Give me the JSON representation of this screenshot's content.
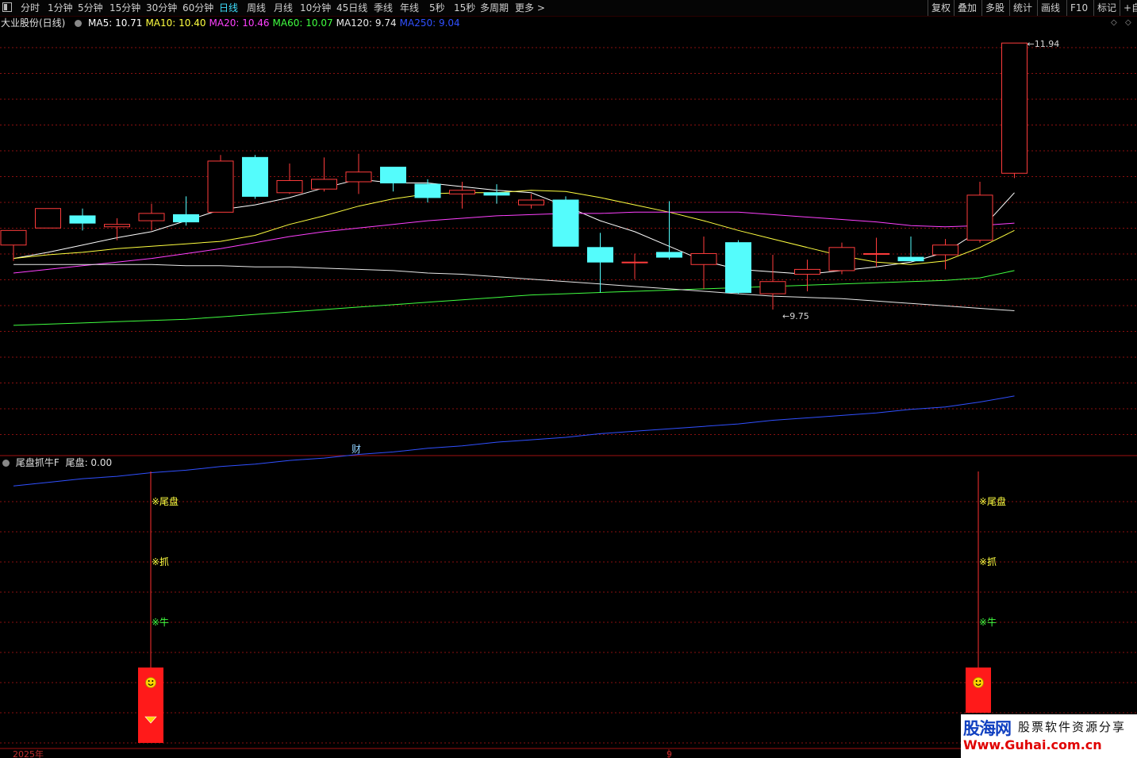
{
  "toolbar": {
    "periods": [
      "分时",
      "1分钟",
      "5分钟",
      "15分钟",
      "30分钟",
      "60分钟",
      "日线",
      "周线",
      "月线",
      "10分钟",
      "45日线",
      "季线",
      "年线",
      "5秒",
      "15秒",
      "多周期",
      "更多 >"
    ],
    "active_period": "日线",
    "right_buttons": [
      "复权",
      "叠加",
      "多股",
      "统计",
      "画线",
      "F10",
      "标记",
      "+自"
    ]
  },
  "main_legend": {
    "title": "大业股份(日线)",
    "items": [
      {
        "label": "MA5: 10.71",
        "color": "#ffffff"
      },
      {
        "label": "MA10: 10.40",
        "color": "#ffff40"
      },
      {
        "label": "MA20: 10.46",
        "color": "#ff40ff"
      },
      {
        "label": "MA60: 10.07",
        "color": "#40ff40"
      },
      {
        "label": "MA120: 9.74",
        "color": "#e8e8e8"
      },
      {
        "label": "MA250: 9.04",
        "color": "#3050ff"
      }
    ]
  },
  "sub_legend": {
    "title": "尾盘抓牛F",
    "value_label": "尾盘: 0.00"
  },
  "annotations": {
    "high_label": "11.94",
    "low_label": "9.75",
    "finance_marker": "财"
  },
  "signal_labels": [
    {
      "text": "※尾盘",
      "color": "#ffff40"
    },
    {
      "text": "※抓",
      "color": "#ffff40"
    },
    {
      "text": "※牛",
      "color": "#40ff40"
    }
  ],
  "time_axis": {
    "labels": [
      "2025年",
      "9"
    ]
  },
  "watermark": {
    "line1": "股海网",
    "line2": "股票软件资源分享",
    "line3": "Www.Guhai.com.cn"
  },
  "colors": {
    "up": "#ff3c3c",
    "down": "#54fcfc",
    "grid": "#8a1010",
    "signal_box": "#ff1a1a"
  },
  "chart_data": {
    "type": "candlestick",
    "title": "大业股份(日线)",
    "price_range": [
      9.0,
      12.0
    ],
    "candles": [
      {
        "o": 10.28,
        "h": 10.4,
        "l": 10.15,
        "c": 10.4
      },
      {
        "o": 10.42,
        "h": 10.58,
        "l": 10.42,
        "c": 10.58
      },
      {
        "o": 10.52,
        "h": 10.58,
        "l": 10.4,
        "c": 10.46
      },
      {
        "o": 10.43,
        "h": 10.5,
        "l": 10.32,
        "c": 10.45
      },
      {
        "o": 10.48,
        "h": 10.62,
        "l": 10.4,
        "c": 10.54
      },
      {
        "o": 10.53,
        "h": 10.68,
        "l": 10.44,
        "c": 10.47
      },
      {
        "o": 10.55,
        "h": 11.02,
        "l": 10.55,
        "c": 10.97
      },
      {
        "o": 11.0,
        "h": 11.02,
        "l": 10.66,
        "c": 10.68
      },
      {
        "o": 10.71,
        "h": 10.95,
        "l": 10.7,
        "c": 10.81
      },
      {
        "o": 10.74,
        "h": 11.0,
        "l": 10.72,
        "c": 10.82
      },
      {
        "o": 10.8,
        "h": 11.03,
        "l": 10.7,
        "c": 10.88
      },
      {
        "o": 10.92,
        "h": 10.92,
        "l": 10.72,
        "c": 10.79
      },
      {
        "o": 10.78,
        "h": 10.82,
        "l": 10.63,
        "c": 10.67
      },
      {
        "o": 10.7,
        "h": 10.8,
        "l": 10.58,
        "c": 10.73
      },
      {
        "o": 10.71,
        "h": 10.78,
        "l": 10.62,
        "c": 10.69
      },
      {
        "o": 10.61,
        "h": 10.7,
        "l": 10.58,
        "c": 10.65
      },
      {
        "o": 10.65,
        "h": 10.68,
        "l": 10.3,
        "c": 10.27
      },
      {
        "o": 10.26,
        "h": 10.38,
        "l": 9.89,
        "c": 10.14
      },
      {
        "o": 10.14,
        "h": 10.21,
        "l": 10.0,
        "c": 10.14
      },
      {
        "o": 10.22,
        "h": 10.64,
        "l": 10.16,
        "c": 10.18
      },
      {
        "o": 10.12,
        "h": 10.35,
        "l": 9.92,
        "c": 10.21
      },
      {
        "o": 10.3,
        "h": 10.32,
        "l": 9.88,
        "c": 9.89
      },
      {
        "o": 9.88,
        "h": 10.2,
        "l": 9.75,
        "c": 9.98
      },
      {
        "o": 10.04,
        "h": 10.16,
        "l": 9.9,
        "c": 10.08
      },
      {
        "o": 10.07,
        "h": 10.3,
        "l": 10.04,
        "c": 10.26
      },
      {
        "o": 10.21,
        "h": 10.34,
        "l": 10.1,
        "c": 10.21
      },
      {
        "o": 10.18,
        "h": 10.35,
        "l": 10.15,
        "c": 10.15
      },
      {
        "o": 10.2,
        "h": 10.33,
        "l": 10.08,
        "c": 10.28
      },
      {
        "o": 10.32,
        "h": 10.8,
        "l": 10.3,
        "c": 10.69
      },
      {
        "o": 10.87,
        "h": 11.94,
        "l": 10.83,
        "c": 11.94
      }
    ],
    "ma": [
      {
        "name": "MA5",
        "color": "#ffffff",
        "values": [
          10.17,
          10.22,
          10.28,
          10.34,
          10.39,
          10.48,
          10.57,
          10.61,
          10.67,
          10.75,
          10.82,
          10.79,
          10.79,
          10.76,
          10.73,
          10.71,
          10.6,
          10.48,
          10.39,
          10.27,
          10.15,
          10.08,
          10.06,
          10.04,
          10.07,
          10.1,
          10.14,
          10.22,
          10.4,
          10.71
        ]
      },
      {
        "name": "MA10",
        "color": "#ffff40",
        "values": [
          10.17,
          10.2,
          10.22,
          10.25,
          10.27,
          10.29,
          10.31,
          10.36,
          10.45,
          10.52,
          10.6,
          10.66,
          10.7,
          10.71,
          10.71,
          10.73,
          10.72,
          10.67,
          10.61,
          10.55,
          10.48,
          10.4,
          10.33,
          10.26,
          10.19,
          10.14,
          10.12,
          10.15,
          10.26,
          10.4
        ]
      },
      {
        "name": "MA20",
        "color": "#ff40ff",
        "values": [
          10.05,
          10.08,
          10.11,
          10.14,
          10.17,
          10.21,
          10.25,
          10.3,
          10.35,
          10.39,
          10.42,
          10.45,
          10.48,
          10.5,
          10.52,
          10.53,
          10.54,
          10.54,
          10.55,
          10.55,
          10.55,
          10.55,
          10.53,
          10.51,
          10.49,
          10.47,
          10.44,
          10.43,
          10.44,
          10.46
        ]
      },
      {
        "name": "MA60",
        "color": "#40ff40",
        "values": [
          9.62,
          9.63,
          9.64,
          9.65,
          9.66,
          9.67,
          9.69,
          9.71,
          9.73,
          9.75,
          9.77,
          9.79,
          9.81,
          9.83,
          9.85,
          9.87,
          9.88,
          9.89,
          9.9,
          9.91,
          9.92,
          9.93,
          9.94,
          9.95,
          9.96,
          9.97,
          9.98,
          9.99,
          10.01,
          10.07
        ]
      },
      {
        "name": "MA120",
        "color": "#e8e8e8",
        "values": [
          10.12,
          10.12,
          10.12,
          10.12,
          10.12,
          10.11,
          10.11,
          10.1,
          10.1,
          10.09,
          10.08,
          10.07,
          10.05,
          10.04,
          10.02,
          10.0,
          9.98,
          9.96,
          9.94,
          9.92,
          9.9,
          9.88,
          9.86,
          9.85,
          9.84,
          9.82,
          9.8,
          9.78,
          9.76,
          9.74
        ]
      },
      {
        "name": "MA250",
        "color": "#3050ff",
        "values": [
          8.3,
          8.33,
          8.36,
          8.38,
          8.41,
          8.43,
          8.46,
          8.48,
          8.51,
          8.53,
          8.56,
          8.58,
          8.61,
          8.63,
          8.66,
          8.68,
          8.7,
          8.73,
          8.75,
          8.77,
          8.79,
          8.81,
          8.84,
          8.86,
          8.88,
          8.9,
          8.93,
          8.95,
          8.99,
          9.04
        ]
      }
    ],
    "signal_days": [
      4,
      28
    ]
  }
}
